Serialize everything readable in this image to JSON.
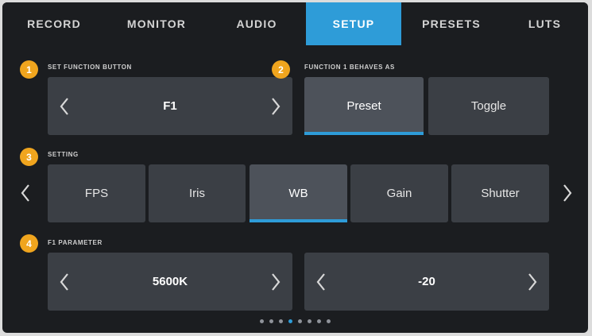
{
  "tabs": [
    {
      "label": "RECORD",
      "active": false
    },
    {
      "label": "MONITOR",
      "active": false
    },
    {
      "label": "AUDIO",
      "active": false
    },
    {
      "label": "SETUP",
      "active": true
    },
    {
      "label": "PRESETS",
      "active": false
    },
    {
      "label": "LUTS",
      "active": false
    }
  ],
  "section1": {
    "badge": "1",
    "label": "SET FUNCTION BUTTON",
    "value": "F1"
  },
  "section2": {
    "badge": "2",
    "label": "FUNCTION 1 BEHAVES AS",
    "options": [
      "Preset",
      "Toggle"
    ],
    "selected": "Preset"
  },
  "section3": {
    "badge": "3",
    "label": "SETTING",
    "options": [
      "FPS",
      "Iris",
      "WB",
      "Gain",
      "Shutter"
    ],
    "selected": "WB"
  },
  "section4": {
    "badge": "4",
    "label": "F1 PARAMETER",
    "value_left": "5600K",
    "value_right": "-20"
  },
  "pagination": {
    "count": 8,
    "current_index": 3
  },
  "colors": {
    "accent": "#2e9cd8",
    "badge": "#f0a51e",
    "box": "#3b3f45",
    "background": "#1b1d20"
  },
  "icons": {
    "chevron_left": "chevron-left-icon",
    "chevron_right": "chevron-right-icon"
  }
}
